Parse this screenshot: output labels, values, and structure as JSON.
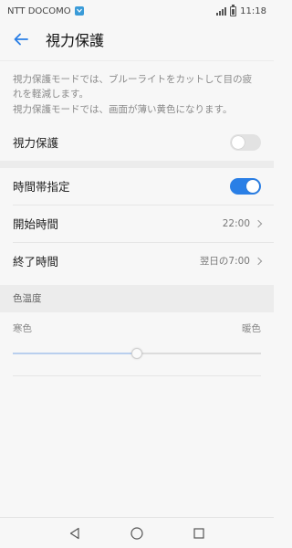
{
  "status_bar": {
    "carrier": "NTT DOCOMO",
    "time": "11:18",
    "icons": [
      "notification-icon",
      "signal-icon",
      "battery-icon"
    ]
  },
  "header": {
    "title": "視力保護",
    "back_icon": "back-arrow-icon"
  },
  "description": {
    "line1": "視力保護モードでは、ブルーライトをカットして目の疲れを軽減します。",
    "line2": "視力保護モードでは、画面が薄い黄色になります。"
  },
  "settings": {
    "eye_protection": {
      "label": "視力保護",
      "enabled": false
    },
    "scheduled": {
      "label": "時間帯指定",
      "enabled": true
    },
    "start_time": {
      "label": "開始時間",
      "value": "22:00"
    },
    "end_time": {
      "label": "終了時間",
      "value": "翌日の7:00"
    }
  },
  "color_temperature": {
    "header": "色温度",
    "cool_label": "寒色",
    "warm_label": "暖色",
    "level": 0.5
  },
  "colors": {
    "accent": "#2a7fe6",
    "background": "#f7f7f7",
    "section_bg": "#ececec"
  },
  "nav_bar": {
    "icons": [
      "back-triangle-icon",
      "home-circle-icon",
      "recents-square-icon"
    ]
  }
}
